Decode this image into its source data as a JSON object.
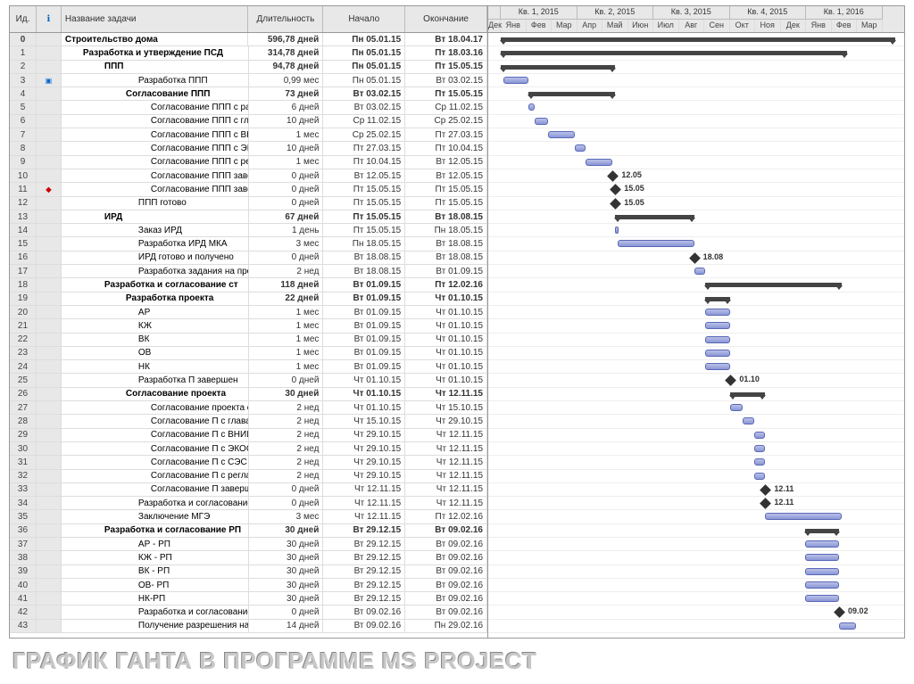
{
  "caption": "ГРАФИК ГАНТА В ПРОГРАММЕ MS PROJECT",
  "columns": {
    "id": "Ид.",
    "indicator": "ℹ",
    "name": "Название задачи",
    "duration": "Длительность",
    "start": "Начало",
    "finish": "Окончание"
  },
  "timeline": {
    "monthWidth": 28.5,
    "startMonth": -2,
    "quarters": [
      "Кв. 1, 2015",
      "Кв. 2, 2015",
      "Кв. 3, 2015",
      "Кв. 4, 2015",
      "Кв. 1, 2016"
    ],
    "months": [
      "Дек",
      "Янв",
      "Фев",
      "Мар",
      "Апр",
      "Май",
      "Июн",
      "Июл",
      "Авг",
      "Сен",
      "Окт",
      "Ноя",
      "Дек",
      "Янв",
      "Фев",
      "Мар"
    ]
  },
  "tasks": [
    {
      "id": 0,
      "lvl": 0,
      "name": "Строительство дома",
      "dur": "596,78 дней",
      "start": "Пн 05.01.15",
      "finish": "Вт 18.04.17",
      "type": "summary",
      "s": 0,
      "e": 15.5
    },
    {
      "id": 1,
      "lvl": 1,
      "name": "Разработка и утверждение ПСД",
      "dur": "314,78 дней",
      "start": "Пн 05.01.15",
      "finish": "Пт 18.03.16",
      "type": "summary",
      "s": 0,
      "e": 13.6
    },
    {
      "id": 2,
      "lvl": 2,
      "name": "ППП",
      "dur": "94,78 дней",
      "start": "Пн 05.01.15",
      "finish": "Пт 15.05.15",
      "type": "summary",
      "s": 0,
      "e": 4.5
    },
    {
      "id": 3,
      "lvl": 4,
      "ind": "info",
      "name": "Разработка ППП",
      "dur": "0,99 мес",
      "start": "Пн 05.01.15",
      "finish": "Вт 03.02.15",
      "type": "task",
      "s": 0.1,
      "e": 1.1
    },
    {
      "id": 4,
      "lvl": 3,
      "name": "Согласование ППП",
      "dur": "73 дней",
      "start": "Вт 03.02.15",
      "finish": "Пт 15.05.15",
      "type": "summary",
      "s": 1.1,
      "e": 4.5
    },
    {
      "id": 5,
      "lvl": 5,
      "name": "Согласование ППП с раи",
      "dur": "6 дней",
      "start": "Вт 03.02.15",
      "finish": "Ср 11.02.15",
      "type": "task",
      "s": 1.1,
      "e": 1.35
    },
    {
      "id": 6,
      "lvl": 5,
      "name": "Согласование ППП с глав",
      "dur": "10 дней",
      "start": "Ср 11.02.15",
      "finish": "Ср 25.02.15",
      "type": "task",
      "s": 1.35,
      "e": 1.85
    },
    {
      "id": 7,
      "lvl": 5,
      "name": "Согласование ППП с ВН",
      "dur": "1 мес",
      "start": "Ср 25.02.15",
      "finish": "Пт 27.03.15",
      "type": "task",
      "s": 1.85,
      "e": 2.9
    },
    {
      "id": 8,
      "lvl": 5,
      "name": "Согласование ППП с ЭК",
      "dur": "10 дней",
      "start": "Пт 27.03.15",
      "finish": "Пт 10.04.15",
      "type": "task",
      "s": 2.9,
      "e": 3.33
    },
    {
      "id": 9,
      "lvl": 5,
      "name": "Согласование ППП с рег",
      "dur": "1 мес",
      "start": "Пт 10.04.15",
      "finish": "Вт 12.05.15",
      "type": "task",
      "s": 3.33,
      "e": 4.4
    },
    {
      "id": 10,
      "lvl": 5,
      "name": "Согласование ППП заве",
      "dur": "0 дней",
      "start": "Вт 12.05.15",
      "finish": "Вт 12.05.15",
      "type": "milestone",
      "s": 4.4,
      "label": "12.05"
    },
    {
      "id": 11,
      "lvl": 5,
      "ind": "red",
      "name": "Согласование ППП заве",
      "dur": "0 дней",
      "start": "Пт 15.05.15",
      "finish": "Пт 15.05.15",
      "type": "milestone",
      "s": 4.5,
      "label": "15.05"
    },
    {
      "id": 12,
      "lvl": 4,
      "name": "ППП готово",
      "dur": "0 дней",
      "start": "Пт 15.05.15",
      "finish": "Пт 15.05.15",
      "type": "milestone",
      "s": 4.5,
      "label": "15.05"
    },
    {
      "id": 13,
      "lvl": 2,
      "name": "ИРД",
      "dur": "67 дней",
      "start": "Пт 15.05.15",
      "finish": "Вт 18.08.15",
      "type": "summary",
      "s": 4.5,
      "e": 7.6
    },
    {
      "id": 14,
      "lvl": 4,
      "name": "Заказ ИРД",
      "dur": "1 день",
      "start": "Пт 15.05.15",
      "finish": "Пн 18.05.15",
      "type": "task",
      "s": 4.5,
      "e": 4.6
    },
    {
      "id": 15,
      "lvl": 4,
      "name": "Разработка ИРД МКА",
      "dur": "3 мес",
      "start": "Пн 18.05.15",
      "finish": "Вт 18.08.15",
      "type": "task",
      "s": 4.6,
      "e": 7.6
    },
    {
      "id": 16,
      "lvl": 4,
      "name": "ИРД готово и получено",
      "dur": "0 дней",
      "start": "Вт 18.08.15",
      "finish": "Вт 18.08.15",
      "type": "milestone",
      "s": 7.6,
      "label": "18.08"
    },
    {
      "id": 17,
      "lvl": 4,
      "name": "Разработка задания на проектир",
      "dur": "2 нед",
      "start": "Вт 18.08.15",
      "finish": "Вт 01.09.15",
      "type": "task",
      "s": 7.6,
      "e": 8.03
    },
    {
      "id": 18,
      "lvl": 2,
      "name": "Разработка и согласование ст",
      "dur": "118 дней",
      "start": "Вт 01.09.15",
      "finish": "Пт 12.02.16",
      "type": "summary",
      "s": 8.03,
      "e": 13.4
    },
    {
      "id": 19,
      "lvl": 3,
      "name": "Разработка проекта",
      "dur": "22 дней",
      "start": "Вт 01.09.15",
      "finish": "Чт 01.10.15",
      "type": "summary",
      "s": 8.03,
      "e": 9.03
    },
    {
      "id": 20,
      "lvl": 4,
      "name": "АР",
      "dur": "1 мес",
      "start": "Вт 01.09.15",
      "finish": "Чт 01.10.15",
      "type": "task",
      "s": 8.03,
      "e": 9.03
    },
    {
      "id": 21,
      "lvl": 4,
      "name": "КЖ",
      "dur": "1 мес",
      "start": "Вт 01.09.15",
      "finish": "Чт 01.10.15",
      "type": "task",
      "s": 8.03,
      "e": 9.03
    },
    {
      "id": 22,
      "lvl": 4,
      "name": "ВК",
      "dur": "1 мес",
      "start": "Вт 01.09.15",
      "finish": "Чт 01.10.15",
      "type": "task",
      "s": 8.03,
      "e": 9.03
    },
    {
      "id": 23,
      "lvl": 4,
      "name": "ОВ",
      "dur": "1 мес",
      "start": "Вт 01.09.15",
      "finish": "Чт 01.10.15",
      "type": "task",
      "s": 8.03,
      "e": 9.03
    },
    {
      "id": 24,
      "lvl": 4,
      "name": "НК",
      "dur": "1 мес",
      "start": "Вт 01.09.15",
      "finish": "Чт 01.10.15",
      "type": "task",
      "s": 8.03,
      "e": 9.03
    },
    {
      "id": 25,
      "lvl": 4,
      "name": "Разработка П завершен",
      "dur": "0 дней",
      "start": "Чт 01.10.15",
      "finish": "Чт 01.10.15",
      "type": "milestone",
      "s": 9.03,
      "label": "01.10"
    },
    {
      "id": 26,
      "lvl": 3,
      "name": "Согласование проекта",
      "dur": "30 дней",
      "start": "Чт 01.10.15",
      "finish": "Чт 12.11.15",
      "type": "summary",
      "s": 9.03,
      "e": 10.4
    },
    {
      "id": 27,
      "lvl": 5,
      "name": "Согласование проекта с",
      "dur": "2 нед",
      "start": "Чт 01.10.15",
      "finish": "Чт 15.10.15",
      "type": "task",
      "s": 9.03,
      "e": 9.5
    },
    {
      "id": 28,
      "lvl": 5,
      "name": "Согласование П с глава",
      "dur": "2 нед",
      "start": "Чт 15.10.15",
      "finish": "Чт 29.10.15",
      "type": "task",
      "s": 9.5,
      "e": 9.97
    },
    {
      "id": 29,
      "lvl": 5,
      "name": "Согласование П с ВНИИ",
      "dur": "2 нед",
      "start": "Чт 29.10.15",
      "finish": "Чт 12.11.15",
      "type": "task",
      "s": 9.97,
      "e": 10.4
    },
    {
      "id": 30,
      "lvl": 5,
      "name": "Согласование П с ЭКОС",
      "dur": "2 нед",
      "start": "Чт 29.10.15",
      "finish": "Чт 12.11.15",
      "type": "task",
      "s": 9.97,
      "e": 10.4
    },
    {
      "id": 31,
      "lvl": 5,
      "name": "Согласование П с СЭС",
      "dur": "2 нед",
      "start": "Чт 29.10.15",
      "finish": "Чт 12.11.15",
      "type": "task",
      "s": 9.97,
      "e": 10.4
    },
    {
      "id": 32,
      "lvl": 5,
      "name": "Согласование П с регла",
      "dur": "2 нед",
      "start": "Чт 29.10.15",
      "finish": "Чт 12.11.15",
      "type": "task",
      "s": 9.97,
      "e": 10.4
    },
    {
      "id": 33,
      "lvl": 5,
      "name": "Согласование П заверш",
      "dur": "0 дней",
      "start": "Чт 12.11.15",
      "finish": "Чт 12.11.15",
      "type": "milestone",
      "s": 10.4,
      "label": "12.11"
    },
    {
      "id": 34,
      "lvl": 4,
      "name": "Разработка и согласование П",
      "dur": "0 дней",
      "start": "Чт 12.11.15",
      "finish": "Чт 12.11.15",
      "type": "milestone",
      "s": 10.4,
      "label": "12.11"
    },
    {
      "id": 35,
      "lvl": 4,
      "name": "Заключение МГЭ",
      "dur": "3 мес",
      "start": "Чт 12.11.15",
      "finish": "Пт 12.02.16",
      "type": "task",
      "s": 10.4,
      "e": 13.4
    },
    {
      "id": 36,
      "lvl": 2,
      "name": "Разработка и согласование РП",
      "dur": "30 дней",
      "start": "Вт 29.12.15",
      "finish": "Вт 09.02.16",
      "type": "summary",
      "s": 11.95,
      "e": 13.3
    },
    {
      "id": 37,
      "lvl": 4,
      "name": "АР - РП",
      "dur": "30 дней",
      "start": "Вт 29.12.15",
      "finish": "Вт 09.02.16",
      "type": "task",
      "s": 11.95,
      "e": 13.3
    },
    {
      "id": 38,
      "lvl": 4,
      "name": "КЖ - РП",
      "dur": "30 дней",
      "start": "Вт 29.12.15",
      "finish": "Вт 09.02.16",
      "type": "task",
      "s": 11.95,
      "e": 13.3
    },
    {
      "id": 39,
      "lvl": 4,
      "name": "ВК - РП",
      "dur": "30 дней",
      "start": "Вт 29.12.15",
      "finish": "Вт 09.02.16",
      "type": "task",
      "s": 11.95,
      "e": 13.3
    },
    {
      "id": 40,
      "lvl": 4,
      "name": "ОВ- РП",
      "dur": "30 дней",
      "start": "Вт 29.12.15",
      "finish": "Вт 09.02.16",
      "type": "task",
      "s": 11.95,
      "e": 13.3
    },
    {
      "id": 41,
      "lvl": 4,
      "name": "НК-РП",
      "dur": "30 дней",
      "start": "Вт 29.12.15",
      "finish": "Вт 09.02.16",
      "type": "task",
      "s": 11.95,
      "e": 13.3
    },
    {
      "id": 42,
      "lvl": 4,
      "name": "Разработка и согласование Р",
      "dur": "0 дней",
      "start": "Вт 09.02.16",
      "finish": "Вт 09.02.16",
      "type": "milestone",
      "s": 13.3,
      "label": "09.02"
    },
    {
      "id": 43,
      "lvl": 4,
      "name": "Получение разрешения на строи",
      "dur": "14 дней",
      "start": "Вт 09.02.16",
      "finish": "Пн 29.02.16",
      "type": "task",
      "s": 13.3,
      "e": 13.95
    }
  ]
}
